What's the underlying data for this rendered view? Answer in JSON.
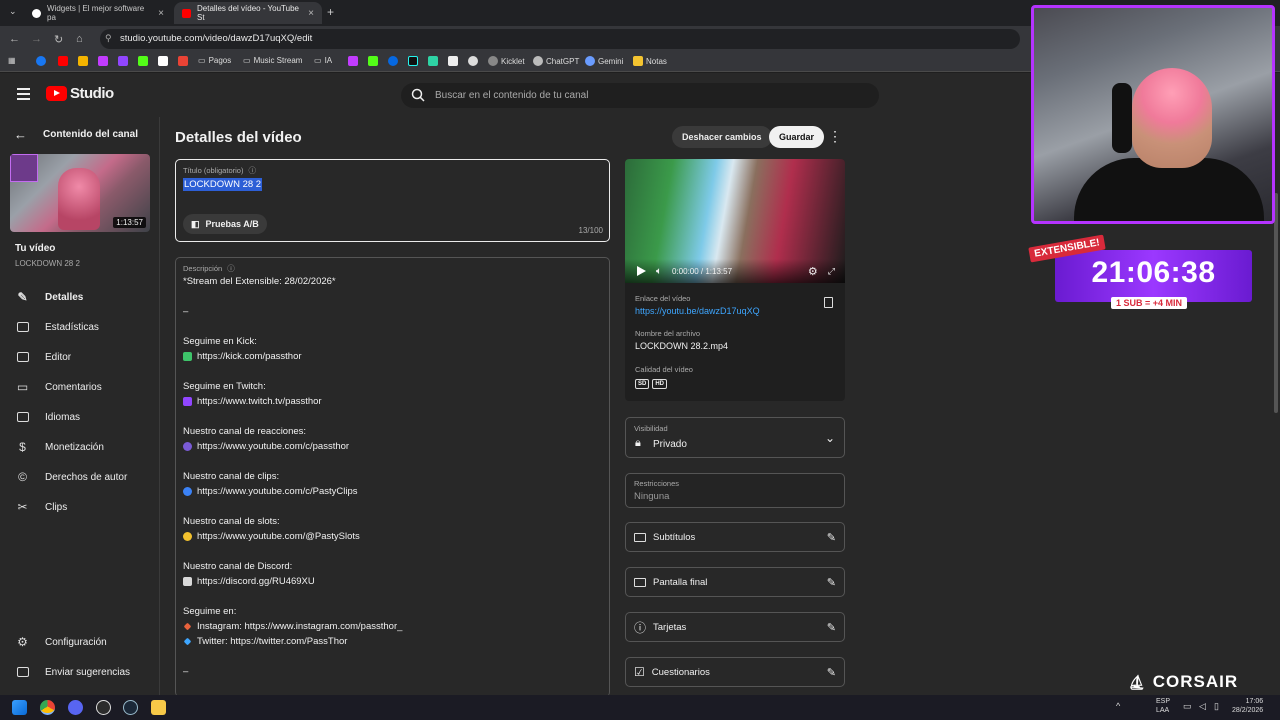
{
  "browser": {
    "tabs": [
      {
        "label": "Widgets | El mejor software pa",
        "active": false,
        "fav_color": "#ffffff"
      },
      {
        "label": "Detalles del vídeo - YouTube St",
        "active": true,
        "fav_color": "#ff0000"
      }
    ],
    "new_tab": "+",
    "url": "studio.youtube.com/video/dawzD17uqXQ/edit",
    "bookmarks": [
      "Pagos",
      "Music Stream",
      "IA",
      "Kicklet",
      "ChatGPT",
      "Gemini",
      "Notas"
    ]
  },
  "studio": {
    "logo": "Studio",
    "search_placeholder": "Buscar en el contenido de tu canal",
    "back_label": "Contenido del canal",
    "thumb_duration": "1:13:57",
    "your_video": "Tu vídeo",
    "your_video_title": "LOCKDOWN 28 2",
    "nav": [
      {
        "label": "Detalles",
        "icon": "pencil-icon",
        "active": true
      },
      {
        "label": "Estadísticas",
        "icon": "analytics-icon",
        "active": false
      },
      {
        "label": "Editor",
        "icon": "editor-icon",
        "active": false
      },
      {
        "label": "Comentarios",
        "icon": "comments-icon",
        "active": false
      },
      {
        "label": "Idiomas",
        "icon": "subtitles-icon",
        "active": false
      },
      {
        "label": "Monetización",
        "icon": "dollar-icon",
        "active": false
      },
      {
        "label": "Derechos de autor",
        "icon": "copyright-icon",
        "active": false
      },
      {
        "label": "Clips",
        "icon": "scissors-icon",
        "active": false
      }
    ],
    "settings": "Configuración",
    "feedback": "Enviar sugerencias"
  },
  "main": {
    "page_title": "Detalles del vídeo",
    "undo_label": "Deshacer cambios",
    "save_label": "Guardar",
    "title_label": "Título (obligatorio)",
    "title_value": "LOCKDOWN 28 2",
    "ab_label": "Pruebas A/B",
    "title_count": "13/100",
    "desc_label": "Descripción",
    "desc_lines": [
      {
        "text": "*Stream del Extensible: 28/02/2026*",
        "emoji": ""
      },
      {
        "text": "–",
        "emoji": ""
      },
      {
        "text": "Seguime en Kick:",
        "emoji": ""
      },
      {
        "text": "https://kick.com/passthor",
        "emoji": "#3ec46a"
      },
      {
        "text": "Seguime en Twitch:",
        "emoji": ""
      },
      {
        "text": "https://www.twitch.tv/passthor",
        "emoji": "#9146ff"
      },
      {
        "text": "Nuestro canal de reacciones:",
        "emoji": ""
      },
      {
        "text": "https://www.youtube.com/c/passthor",
        "emoji": "#7a5bd6"
      },
      {
        "text": "Nuestro canal de clips:",
        "emoji": ""
      },
      {
        "text": "https://www.youtube.com/c/PastyClips",
        "emoji": "#3b82f6"
      },
      {
        "text": "Nuestro canal de slots:",
        "emoji": ""
      },
      {
        "text": "https://www.youtube.com/@PastySlots",
        "emoji": "#f2c12e"
      },
      {
        "text": "Nuestro canal de Discord:",
        "emoji": ""
      },
      {
        "text": "https://discord.gg/RU469XU",
        "emoji": "#d9d9d9"
      },
      {
        "text": "Seguime en:",
        "emoji": ""
      },
      {
        "text": "Instagram: https://www.instagram.com/passthor_",
        "emoji": "#e8623c"
      },
      {
        "text": "Twitter: https://twitter.com/PassThor",
        "emoji": "#3ea6ff"
      },
      {
        "text": "–",
        "emoji": ""
      }
    ]
  },
  "video_panel": {
    "time": "0:00:00 / 1:13:57",
    "link_label": "Enlace del vídeo",
    "link_value": "https://youtu.be/dawzD17uqXQ",
    "file_label": "Nombre del archivo",
    "file_value": "LOCKDOWN 28.2.mp4",
    "quality_label": "Calidad del vídeo",
    "quality": [
      "SD",
      "HD"
    ]
  },
  "visibility": {
    "label": "Visibilidad",
    "value": "Privado"
  },
  "restrictions": {
    "label": "Restricciones",
    "value": "Ninguna"
  },
  "panel_buttons": [
    {
      "label": "Subtítulos",
      "icon": "subtitles-icon"
    },
    {
      "label": "Pantalla final",
      "icon": "end-screen-icon"
    },
    {
      "label": "Tarjetas",
      "icon": "info-icon"
    },
    {
      "label": "Cuestionarios",
      "icon": "checkbox-icon"
    }
  ],
  "overlay": {
    "badge": "EXTENSIBLE!",
    "timer": "21:06:38",
    "sub_rule": "1 SUB = +4 MIN",
    "brand": "CORSAIR"
  },
  "taskbar": {
    "lang_1": "ESP",
    "lang_2": "LAA",
    "time": "17:06",
    "date": "28/2/2026"
  }
}
